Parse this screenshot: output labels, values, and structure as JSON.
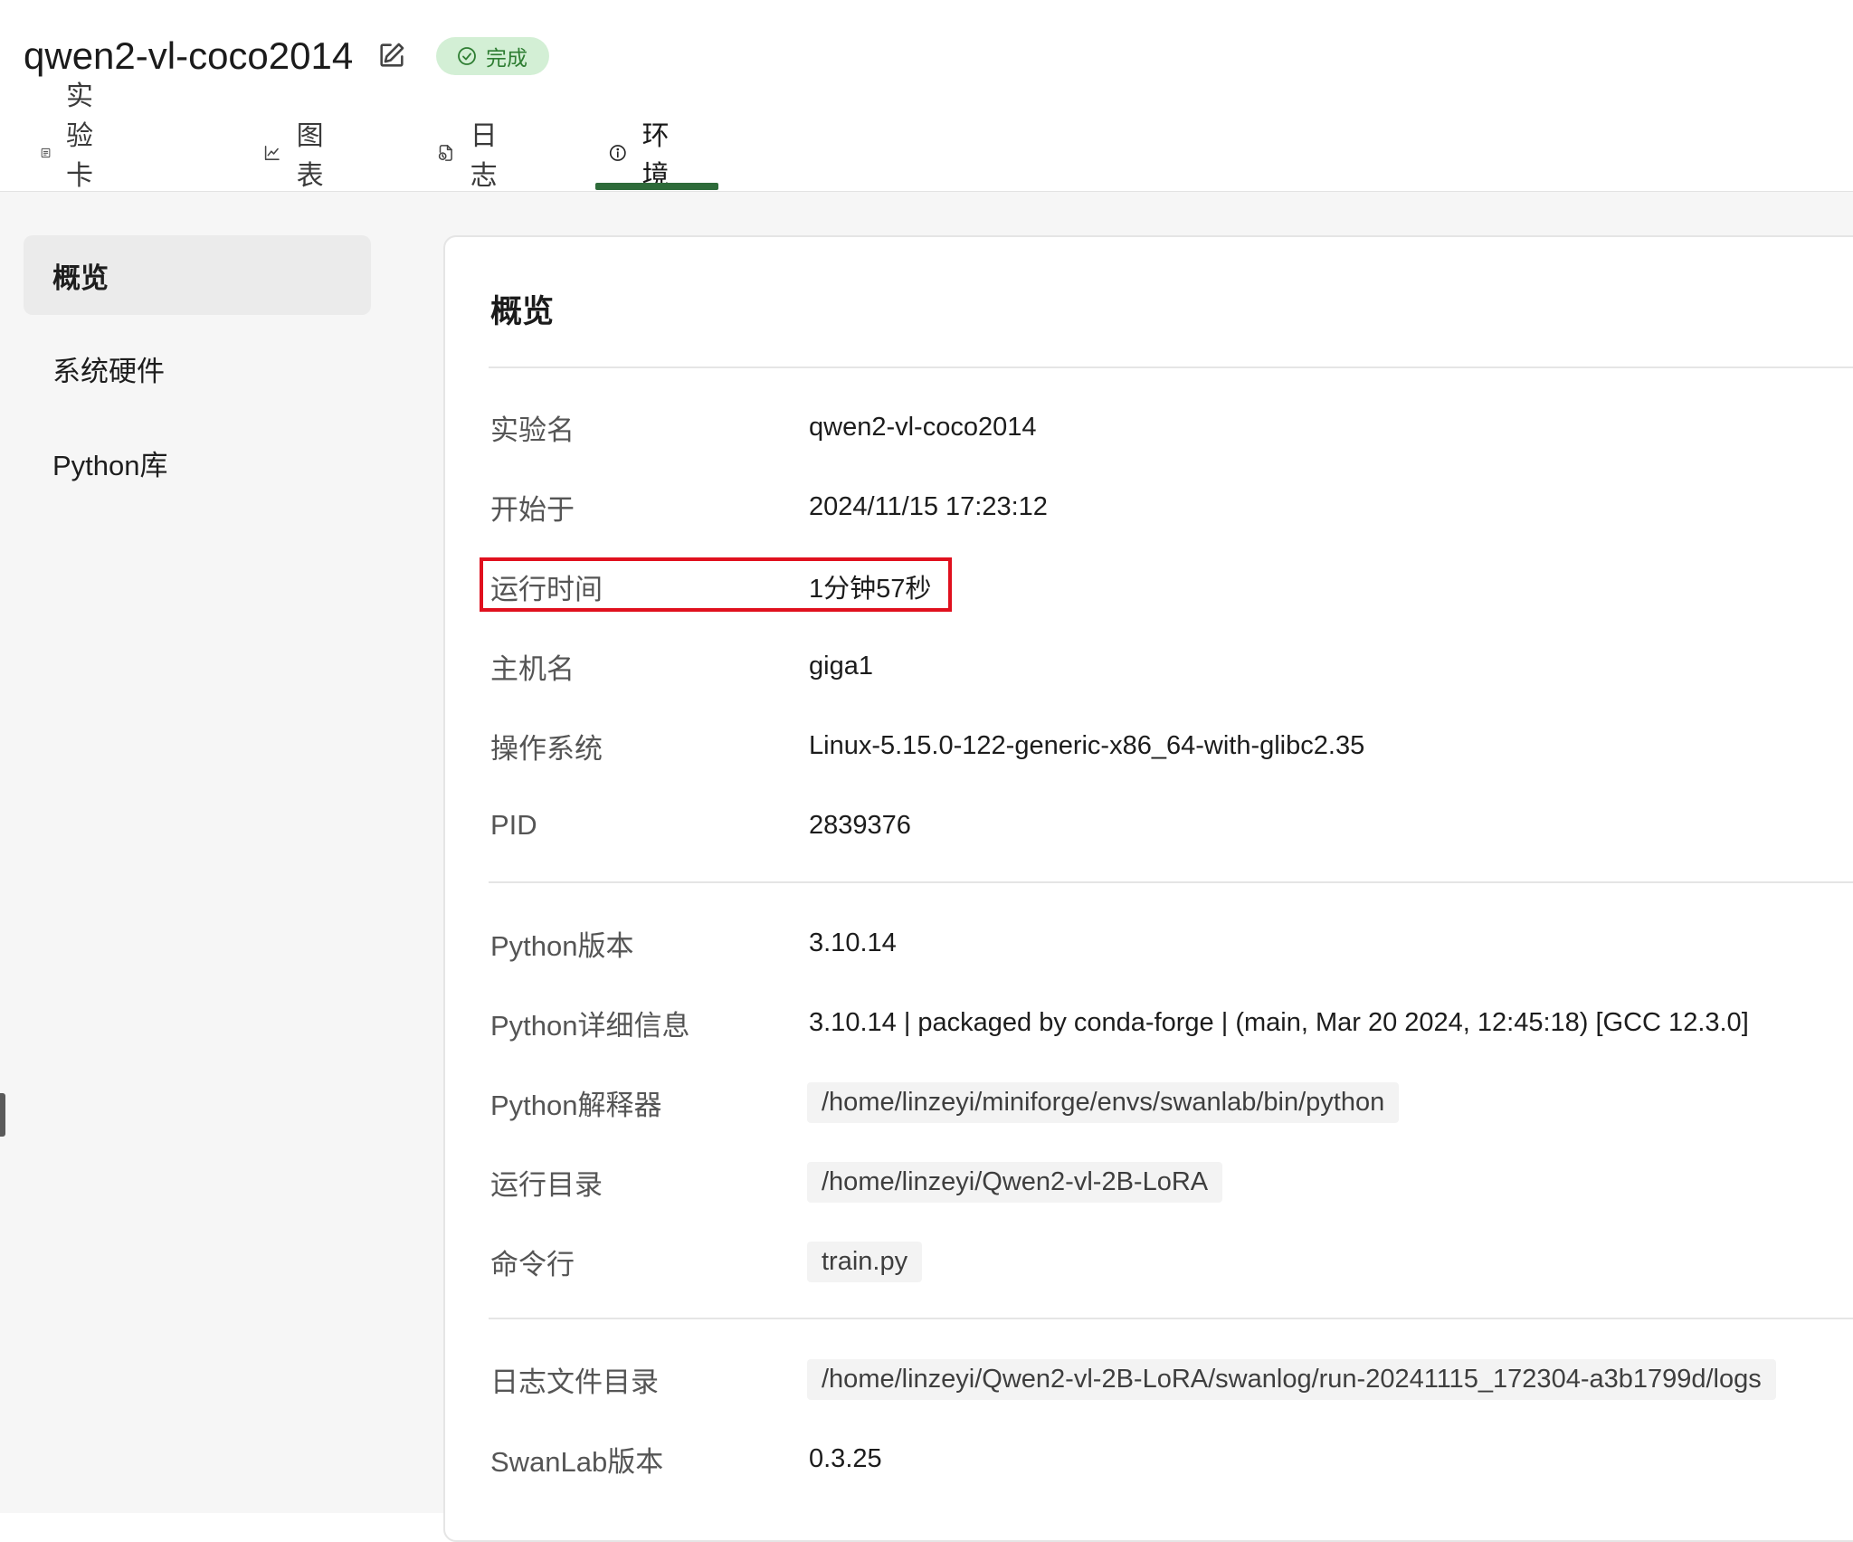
{
  "header": {
    "title": "qwen2-vl-coco2014",
    "status": "完成"
  },
  "tabs": [
    {
      "label": "实验卡片",
      "icon": "card-icon"
    },
    {
      "label": "图表",
      "icon": "line-chart-icon"
    },
    {
      "label": "日志",
      "icon": "log-icon"
    },
    {
      "label": "环境",
      "icon": "info-icon",
      "active": true
    }
  ],
  "sidebar": {
    "items": [
      {
        "label": "概览",
        "active": true
      },
      {
        "label": "系统硬件"
      },
      {
        "label": "Python库"
      }
    ]
  },
  "panel": {
    "title": "概览",
    "rows": [
      {
        "label": "实验名",
        "value": "qwen2-vl-coco2014"
      },
      {
        "label": "开始于",
        "value": "2024/11/15 17:23:12"
      },
      {
        "label": "运行时间",
        "value": "1分钟57秒"
      },
      {
        "label": "主机名",
        "value": "giga1"
      },
      {
        "label": "操作系统",
        "value": "Linux-5.15.0-122-generic-x86_64-with-glibc2.35"
      },
      {
        "label": "PID",
        "value": "2839376"
      },
      {
        "label": "Python版本",
        "value": "3.10.14"
      },
      {
        "label": "Python详细信息",
        "value": "3.10.14 | packaged by conda-forge | (main, Mar 20 2024, 12:45:18) [GCC 12.3.0]"
      },
      {
        "label": "Python解释器",
        "value": "/home/linzeyi/miniforge/envs/swanlab/bin/python"
      },
      {
        "label": "运行目录",
        "value": "/home/linzeyi/Qwen2-vl-2B-LoRA"
      },
      {
        "label": "命令行",
        "value": "train.py"
      },
      {
        "label": "日志文件目录",
        "value": "/home/linzeyi/Qwen2-vl-2B-LoRA/swanlog/run-20241115_172304-a3b1799d/logs"
      },
      {
        "label": "SwanLab版本",
        "value": "0.3.25"
      }
    ]
  },
  "colors": {
    "accent": "#2e6b3a",
    "status_bg": "#d3efd5",
    "status_text": "#2e7d32",
    "highlight": "#e0101e"
  }
}
